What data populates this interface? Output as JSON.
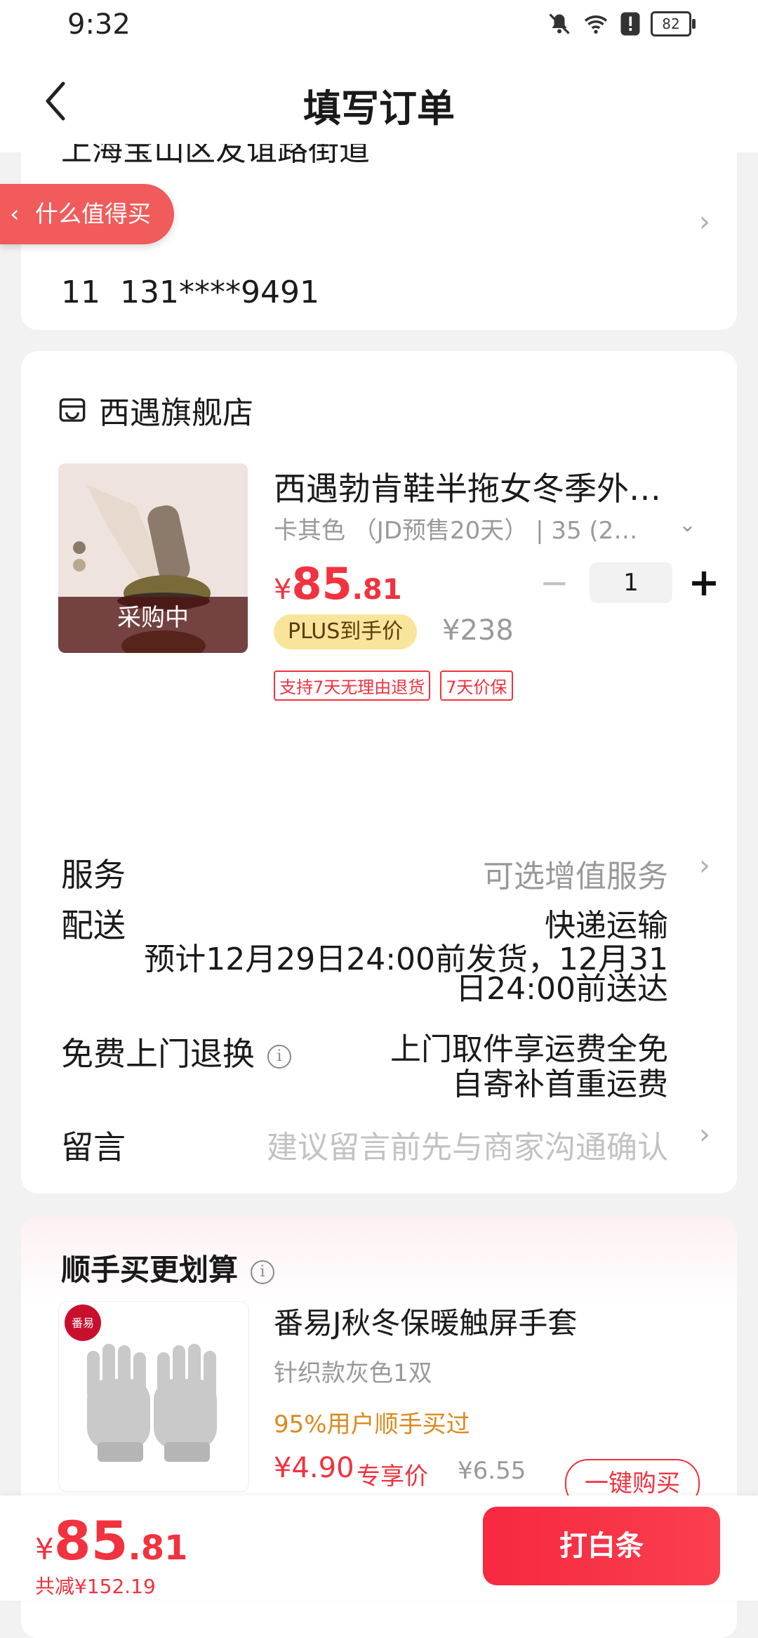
{
  "status_bar": {
    "time": "9:32",
    "battery": "82"
  },
  "header": {
    "title": "填写订单"
  },
  "address": {
    "line": "上海宝山区友谊路街道",
    "contact_name": "11",
    "phone": "131****9491"
  },
  "floating_tag": {
    "label": "什么值得买"
  },
  "store": {
    "name": "西遇旗舰店",
    "product": {
      "title": "西遇勃肯鞋半拖女冬季外…",
      "spec": "卡其色 （JD预售20天） | 35 (2…",
      "image_overlay": "采购中",
      "price_yen": "¥",
      "price_int": "85",
      "price_dec": ".81",
      "quantity": "1",
      "plus_badge": "PLUS到手价",
      "original_price": "¥238",
      "tags": [
        "支持7天无理由退货",
        "7天价保"
      ]
    },
    "service": {
      "label": "服务",
      "value": "可选增值服务"
    },
    "delivery": {
      "label": "配送",
      "method": "快递运输",
      "estimate_line1": "预计12月29日24:00前发货，12月31",
      "estimate_line2": "日24:00前送达"
    },
    "free_return": {
      "label": "免费上门退换",
      "line1": "上门取件享运费全免",
      "line2": "自寄补首重运费"
    },
    "message": {
      "label": "留言",
      "placeholder": "建议留言前先与商家沟通确认"
    }
  },
  "recommend": {
    "title": "顺手买更划算",
    "item": {
      "name": "番易J秋冬保暖触屏手套",
      "spec": "针织款灰色1双",
      "hint": "95%用户顺手买过",
      "price": "¥4.90",
      "exclusive_label": "专享价",
      "original_price": "¥6.55",
      "buy_label": "一键购买",
      "logo_text": "番易"
    }
  },
  "bottom_bar": {
    "total_yen": "¥",
    "total_int": "85",
    "total_dec": ".81",
    "saving": "共减¥152.19",
    "pay_label": "打白条"
  },
  "colors": {
    "accent": "#f1323f",
    "plus_badge_bg": "#f8e49a",
    "hint": "#d98a1e"
  }
}
